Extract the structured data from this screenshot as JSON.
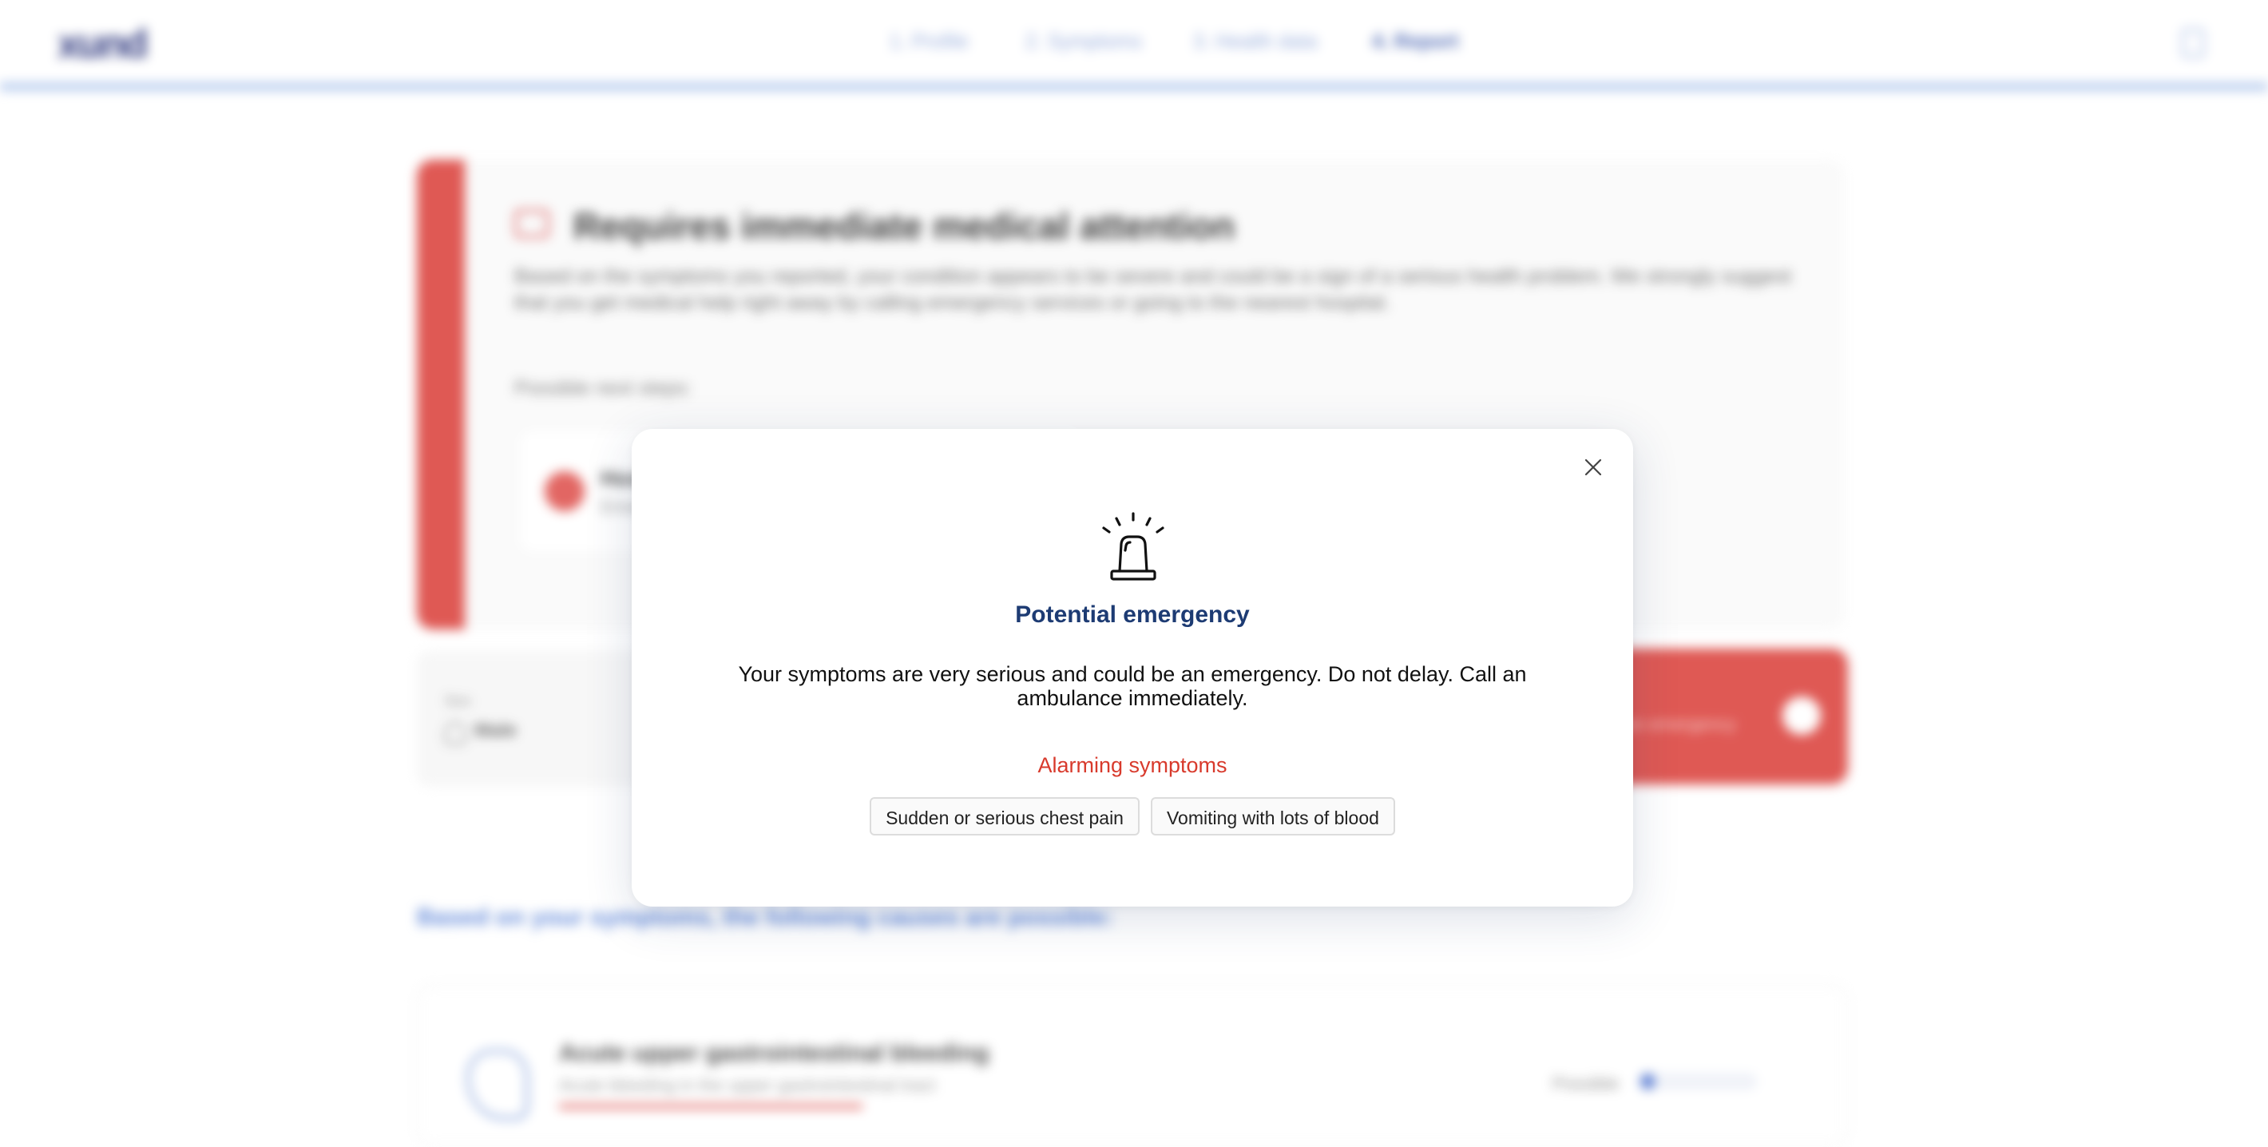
{
  "header": {
    "logo": "xund",
    "steps": [
      {
        "label": "1. Profile",
        "active": false
      },
      {
        "label": "2. Symptoms",
        "active": false
      },
      {
        "label": "3. Health data",
        "active": false
      },
      {
        "label": "4. Report",
        "active": true
      }
    ],
    "accent_color": "#a9c2ec"
  },
  "alert": {
    "title": "Requires immediate medical attention",
    "description": "Based on the symptoms you reported, your condition appears to be severe and could be a sign of a serious health problem. We strongly suggest that you get medical help right away by calling emergency services or going to the nearest hospital.",
    "next_steps_label": "Possible next steps:",
    "hospital_title": "Hospital",
    "hospital_sub": "Emergency",
    "stripe_color": "#dd4b46"
  },
  "profile": {
    "sex_label": "Sex",
    "sex_value": "Male"
  },
  "call": {
    "text": "In an emergency"
  },
  "causes": {
    "title": "Based on your symptoms, the following causes are possible:",
    "items": [
      {
        "title": "Acute upper gastrointestinal bleeding",
        "subtitle": "Acute bleeding in the upper gastrointestinal tract",
        "likelihood_label": "Possible",
        "likelihood_fraction": 0.12
      }
    ]
  },
  "modal": {
    "icon": "siren-icon",
    "title": "Potential emergency",
    "text": "Your symptoms are very serious and could be an emergency. Do not delay. Call an ambulance immediately.",
    "alarming_label": "Alarming symptoms",
    "symptoms": [
      "Sudden or serious chest pain",
      "Vomiting with lots of blood"
    ],
    "title_color": "#1d3b73",
    "alarm_color": "#d83a2c"
  }
}
